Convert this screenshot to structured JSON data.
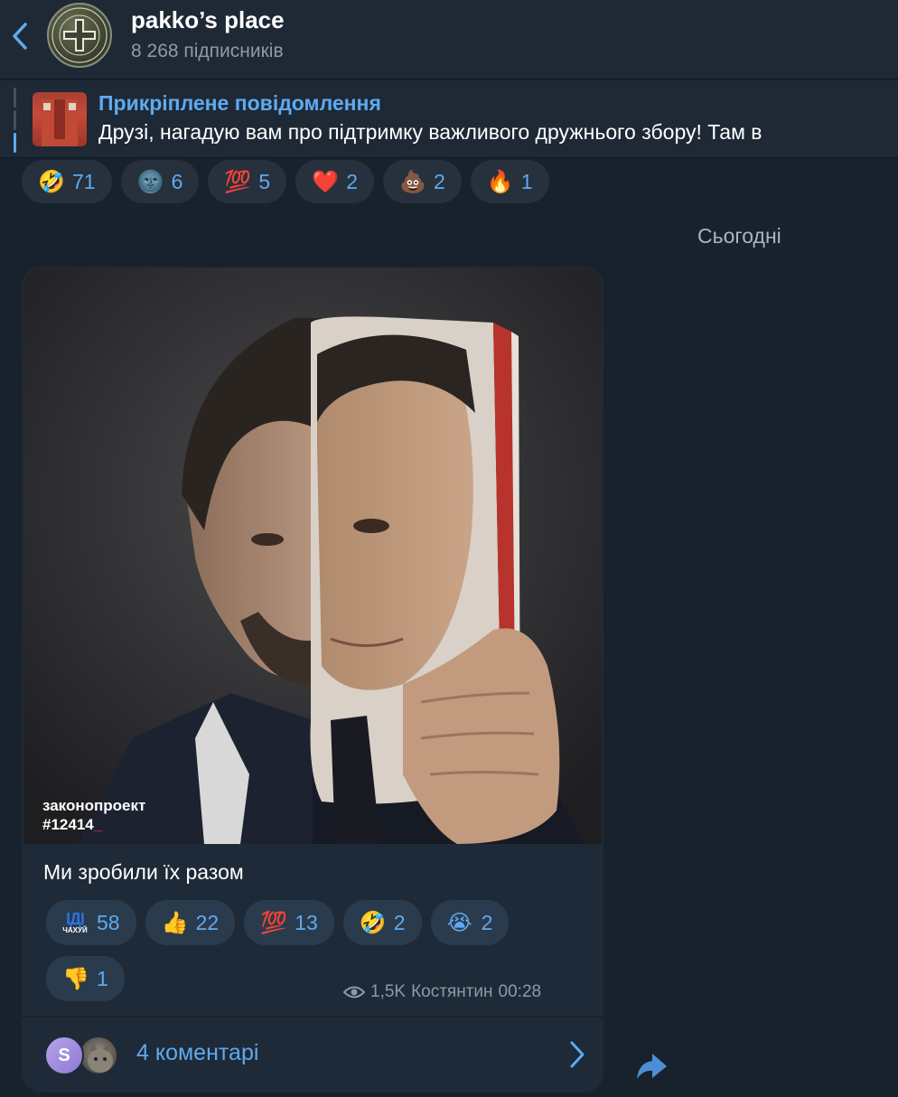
{
  "header": {
    "channel_name": "pakko’s place",
    "subscribers": "8 268 підписників"
  },
  "pinned": {
    "title": "Прикріплене повідомлення",
    "text": "Друзі, нагадую вам про підтримку важливого дружнього збору!  Там в"
  },
  "top_reactions": [
    {
      "emoji": "🤣",
      "count": "71"
    },
    {
      "emoji": "🌚",
      "count": "6"
    },
    {
      "emoji": "💯",
      "count": "5"
    },
    {
      "emoji": "❤️",
      "count": "2"
    },
    {
      "emoji": "💩",
      "count": "2"
    },
    {
      "emoji": "🔥",
      "count": "1"
    }
  ],
  "date_separator": "Сьогодні",
  "message": {
    "photo_label_line1": "законопроект",
    "photo_label_line2": "#12414",
    "caption": "Ми зробили їх разом",
    "reactions": [
      {
        "emoji": "ІДІ ЧАХУЙ",
        "count": "58",
        "custom": true
      },
      {
        "emoji": "👍",
        "count": "22"
      },
      {
        "emoji": "💯",
        "count": "13"
      },
      {
        "emoji": "🤣",
        "count": "2"
      },
      {
        "emoji": "😭",
        "count": "2"
      },
      {
        "emoji": "👎",
        "count": "1"
      }
    ],
    "views": "1,5K",
    "author": "Костянтин",
    "time": "00:28",
    "comments_label": "4 коментарі",
    "commenter_initial": "S"
  },
  "colors": {
    "background": "#18222d",
    "header": "#1e2935",
    "bubble": "#1e2a37",
    "accent": "#5eaaf0"
  }
}
